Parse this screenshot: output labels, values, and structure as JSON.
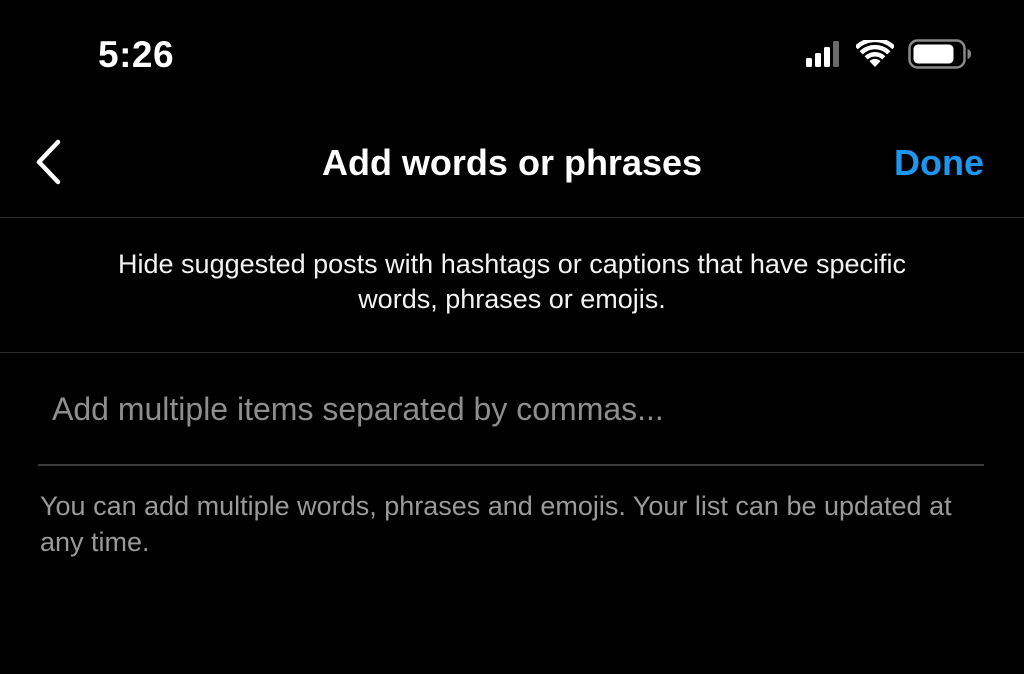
{
  "status_bar": {
    "time": "5:26",
    "icons": [
      "cellular-signal-icon",
      "wifi-icon",
      "battery-icon"
    ]
  },
  "nav": {
    "back_icon": "chevron-left-icon",
    "title": "Add words or phrases",
    "done_label": "Done"
  },
  "description": "Hide suggested posts with hashtags or captions that have specific words, phrases or emojis.",
  "input": {
    "value": "",
    "placeholder": "Add multiple items separated by commas..."
  },
  "helper_text": "You can add multiple words, phrases and emojis. Your list can be updated at any time.",
  "colors": {
    "background": "#000000",
    "accent": "#1d96f0",
    "text_primary": "#ffffff",
    "text_secondary": "#9a9a9a",
    "divider": "#2a2a2a"
  }
}
